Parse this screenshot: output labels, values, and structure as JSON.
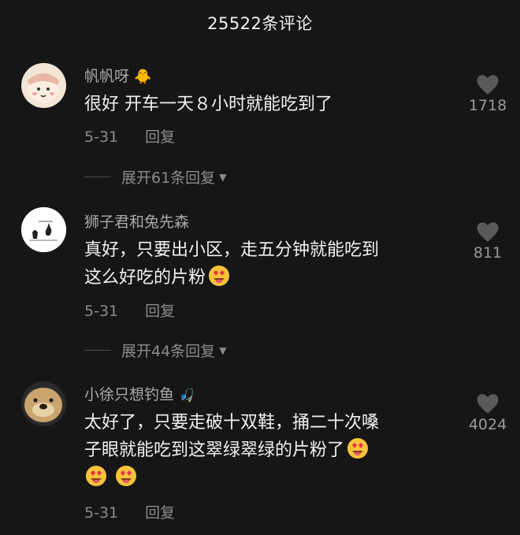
{
  "header": {
    "title": "25522条评论"
  },
  "comments": [
    {
      "username": "帆帆呀",
      "username_badge": "chick-emoji",
      "text": "很好 开车一天８小时就能吃到了",
      "date": "5-31",
      "reply_label": "回复",
      "likes": "1718",
      "expand_label": "展开61条回复"
    },
    {
      "username": "狮子君和兔先森",
      "text_line1": "真好，只要出小区，走五分钟就能吃到",
      "text_line2": "这么好吃的片粉",
      "date": "5-31",
      "reply_label": "回复",
      "likes": "811",
      "expand_label": "展开44条回复"
    },
    {
      "username": "小徐只想钓鱼",
      "username_badge": "fishing-emoji",
      "text_line1": "太好了，只要走破十双鞋，捅二十次嗓",
      "text_line2": "子眼就能吃到这翠绿翠绿的片粉了",
      "date": "5-31",
      "reply_label": "回复",
      "likes": "4024"
    }
  ],
  "colors": {
    "background": "#161616",
    "secondary_text": "#8b8b8b",
    "heart": "#5a5a5a"
  }
}
